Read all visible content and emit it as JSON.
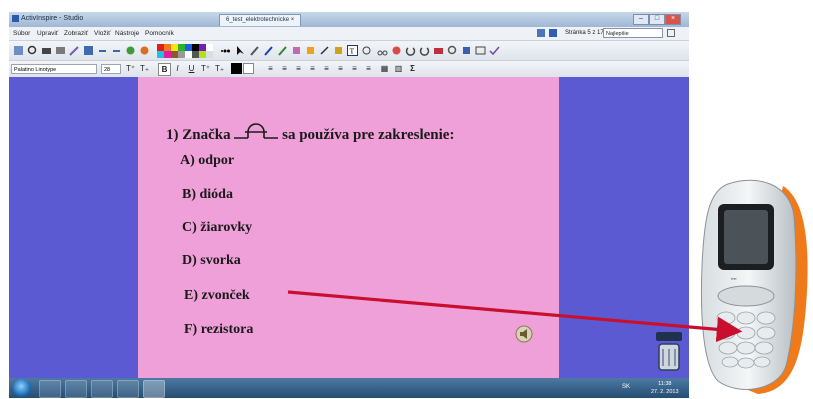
{
  "window": {
    "title": "ActivInspire - Studio",
    "document_tab": "6_test_elektrotechnicke",
    "page_counter": "Stránka 5 z 17",
    "zoom": "Najlepšie prispôsobenie"
  },
  "menu": {
    "items": [
      "Súbor",
      "Upraviť",
      "Zobraziť",
      "Vložiť",
      "Nástroje",
      "Pomocník"
    ]
  },
  "format_bar": {
    "font": "Palatino Linotype",
    "size": "28",
    "bold": "B",
    "italic": "I",
    "underline": "U",
    "superscript": "T⁺",
    "subscript": "T₊",
    "sigma": "Σ"
  },
  "flipchart": {
    "question_number": "1)",
    "question_before": "Značka",
    "question_after": "sa používa pre zakreslenie:",
    "answers": [
      {
        "letter": "A)",
        "text": "odpor"
      },
      {
        "letter": "B)",
        "text": "dióda"
      },
      {
        "letter": "C)",
        "text": "žiarovky"
      },
      {
        "letter": "D)",
        "text": "svorka"
      },
      {
        "letter": "E)",
        "text": "zvonček"
      },
      {
        "letter": "F)",
        "text": "rezistora"
      }
    ]
  },
  "taskbar": {
    "language": "SK",
    "time": "11:38",
    "date": "27. 2. 2013"
  },
  "colors": {
    "canvas_background": "#5b5ad2",
    "flipchart_background": "#f0a0d8",
    "arrow": "#c8102e",
    "phone_accent": "#f07a1a"
  }
}
